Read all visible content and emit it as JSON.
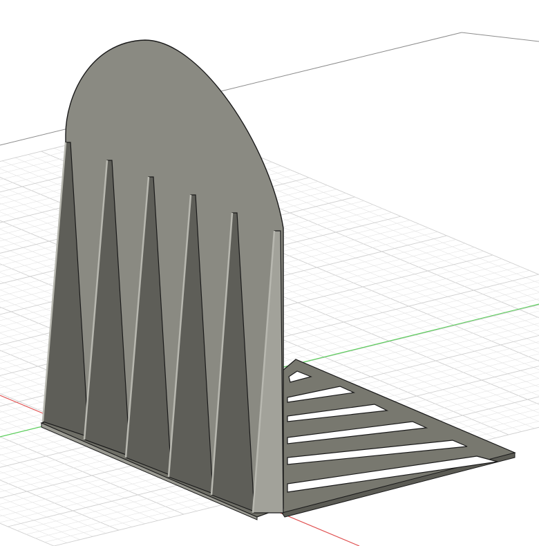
{
  "viewport": {
    "background": "#ffffff",
    "grid_minor_color": "#e4e4e4",
    "grid_major_color": "#cfcfcf",
    "grid_boundary_color": "#8c8c8c",
    "x_axis_color": "#e05050",
    "y_axis_color": "#5ccf5c"
  },
  "model": {
    "face_color": "#8a8a82",
    "rib_dark_color": "#5e5e58",
    "rib_light_color": "#a2a29a",
    "edge_color": "#1a1a1a",
    "base_color": "#78786f"
  }
}
